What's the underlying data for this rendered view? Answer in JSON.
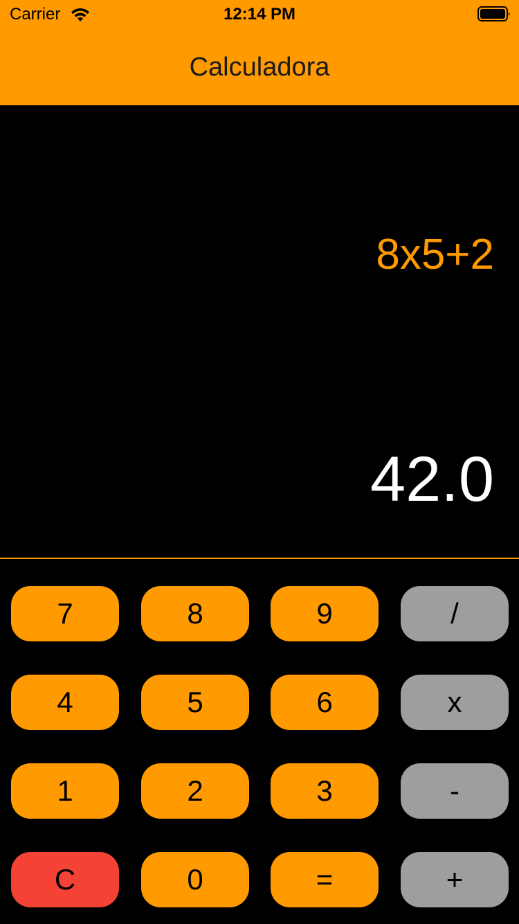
{
  "status_bar": {
    "carrier": "Carrier",
    "time": "12:14 PM"
  },
  "nav": {
    "title": "Calculadora"
  },
  "display": {
    "expression": "8x5+2",
    "result": "42.0"
  },
  "colors": {
    "accent": "#ff9a00",
    "operator": "#9e9e9e",
    "clear": "#f44336",
    "background": "#000000"
  },
  "keypad": {
    "rows": [
      [
        {
          "label": "7",
          "type": "digit"
        },
        {
          "label": "8",
          "type": "digit"
        },
        {
          "label": "9",
          "type": "digit"
        },
        {
          "label": "/",
          "type": "operator"
        }
      ],
      [
        {
          "label": "4",
          "type": "digit"
        },
        {
          "label": "5",
          "type": "digit"
        },
        {
          "label": "6",
          "type": "digit"
        },
        {
          "label": "x",
          "type": "operator"
        }
      ],
      [
        {
          "label": "1",
          "type": "digit"
        },
        {
          "label": "2",
          "type": "digit"
        },
        {
          "label": "3",
          "type": "digit"
        },
        {
          "label": "-",
          "type": "operator"
        }
      ],
      [
        {
          "label": "C",
          "type": "clear"
        },
        {
          "label": "0",
          "type": "digit"
        },
        {
          "label": "=",
          "type": "equals"
        },
        {
          "label": "+",
          "type": "operator"
        }
      ]
    ]
  }
}
